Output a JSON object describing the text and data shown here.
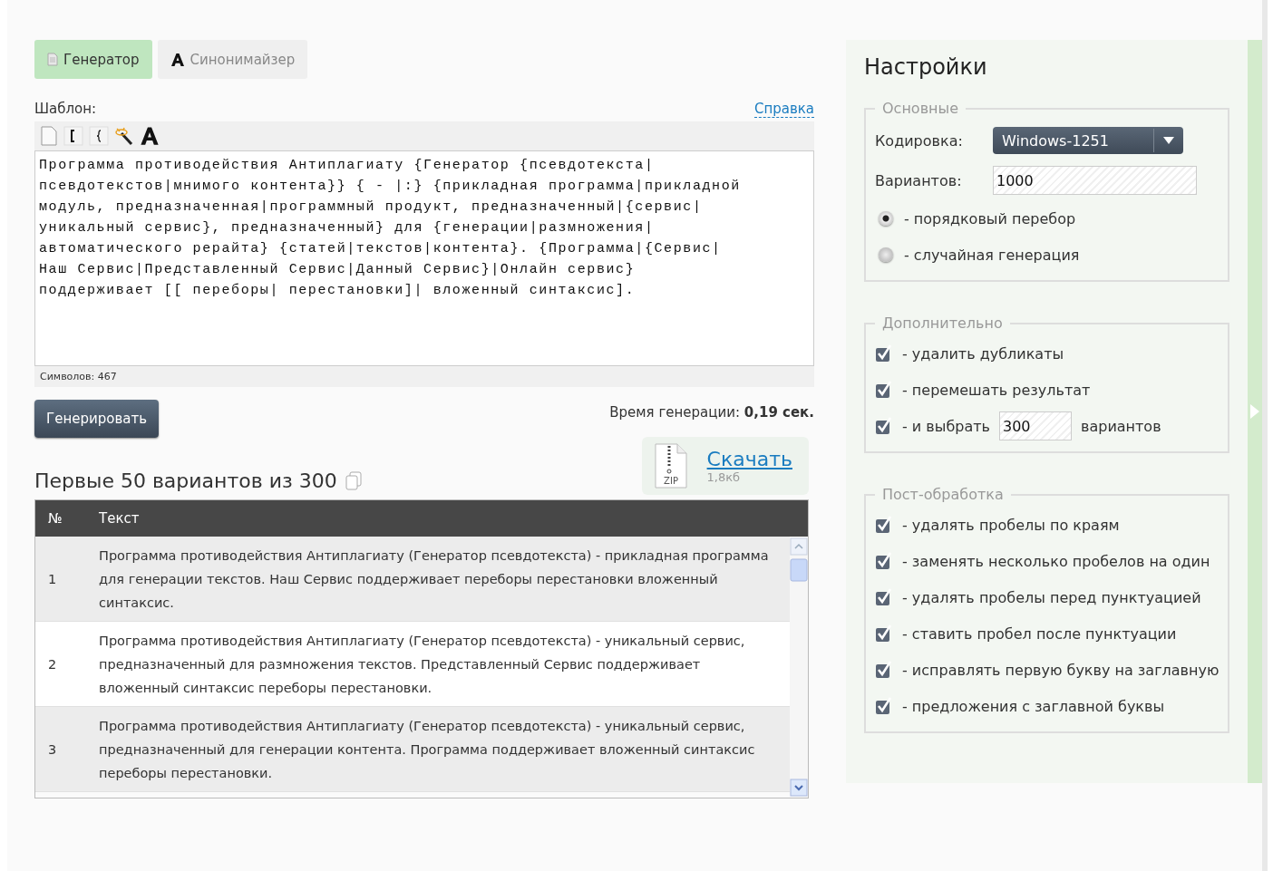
{
  "tabs": [
    {
      "label": "Генератор",
      "selected": true
    },
    {
      "label": "Синонимайзер",
      "selected": false
    }
  ],
  "template": {
    "label": "Шаблон:",
    "help_link": "Справка",
    "value": "Программа противодействия Антиплагиату {Генератор {псевдотекста|\nпсевдотекстов|мнимого контента}} { - |:} {прикладная программа|прикладной\nмодуль, предназначенная|программный продукт, предназначенный|{сервис|\nуникальный сервис}, предназначенный} для {генерации|размножения|\nавтоматического рерайта} {статей|текстов|контента}. {Программа|{Сервис|\nНаш Сервис|Представленный Сервис|Данный Сервис}|Онлайн сервис}\nподдерживает [[ переборы| перестановки]| вложенный синтаксис].",
    "char_count": "Символов: 467"
  },
  "generate_button": "Генерировать",
  "generation_time": {
    "label": "Время генерации:",
    "value": "0,19 сек."
  },
  "download": {
    "link": "Скачать",
    "size": "1,8кб",
    "file_type": "ZIP"
  },
  "results": {
    "title": "Первые 50 вариантов из 300",
    "columns": [
      "№",
      "Текст"
    ],
    "rows": [
      {
        "n": "1",
        "text": "Программа противодействия Антиплагиату (Генератор псевдотекста) - прикладная программа для генерации текстов. Наш Сервис поддерживает переборы перестановки вложенный синтаксис."
      },
      {
        "n": "2",
        "text": "Программа противодействия Антиплагиату (Генератор псевдотекста) - уникальный сервис, предназначенный для размножения текстов. Представленный Сервис поддерживает вложенный синтаксис переборы перестановки."
      },
      {
        "n": "3",
        "text": "Программа противодействия Антиплагиату (Генератор псевдотекста) - уникальный сервис, предназначенный для генерации контента. Программа поддерживает вложенный синтаксис переборы перестановки."
      }
    ]
  },
  "settings": {
    "title": "Настройки",
    "groups": [
      {
        "legend": "Основные",
        "items": [
          {
            "kind": "select",
            "label": "Кодировка:",
            "value": "Windows-1251"
          },
          {
            "kind": "input",
            "label": "Вариантов:",
            "value": "1000"
          },
          {
            "kind": "radio",
            "label": "- порядковый перебор",
            "selected": true
          },
          {
            "kind": "radio",
            "label": "- случайная генерация",
            "selected": false
          }
        ]
      },
      {
        "legend": "Дополнительно",
        "items": [
          {
            "kind": "checkbox",
            "label": "- удалить дубликаты",
            "checked": true
          },
          {
            "kind": "checkbox",
            "label": "- перемешать результат",
            "checked": true
          },
          {
            "kind": "checkbox-input",
            "label": "- и выбрать",
            "value": "300",
            "suffix": "вариантов",
            "checked": true
          }
        ]
      },
      {
        "legend": "Пост-обработка",
        "items": [
          {
            "kind": "checkbox",
            "label": "- удалять пробелы по краям",
            "checked": true
          },
          {
            "kind": "checkbox",
            "label": "- заменять несколько пробелов на один",
            "checked": true
          },
          {
            "kind": "checkbox",
            "label": "- удалять пробелы перед пунктуацией",
            "checked": true
          },
          {
            "kind": "checkbox",
            "label": "- ставить пробел после пунктуации",
            "checked": true
          },
          {
            "kind": "checkbox",
            "label": "- исправлять первую букву на заглавную",
            "checked": true
          },
          {
            "kind": "checkbox",
            "label": "- предложения с заглавной буквы",
            "checked": true
          }
        ]
      }
    ]
  }
}
